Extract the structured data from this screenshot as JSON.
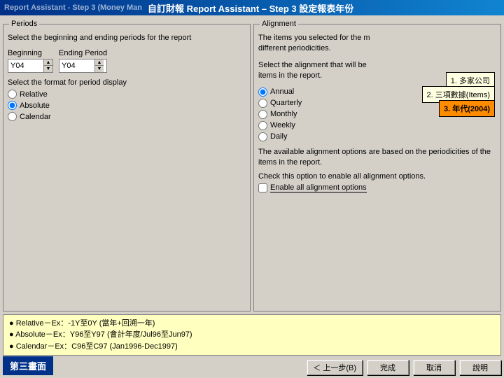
{
  "titleBar": {
    "left": "Report Assistant - Step 3  (Money Man",
    "right": "自訂財報 Report Assistant – Step 3 設定報表年份"
  },
  "periods": {
    "panelTitle": "Periods",
    "description": "Select the beginning and ending periods for the report",
    "beginLabel": "Beginning",
    "endLabel": "Ending Period",
    "beginValue": "Y04",
    "endValue": "Y04",
    "formatLabel": "Select the format for period display",
    "formats": [
      {
        "id": "relative",
        "label": "Relative",
        "checked": false
      },
      {
        "id": "absolute",
        "label": "Absolute",
        "checked": true
      },
      {
        "id": "calendar",
        "label": "Calendar",
        "checked": false
      }
    ]
  },
  "alignment": {
    "panelTitle": "Alignment",
    "description": "The items you selected for the m different periodicities.",
    "description2": "Select the alignment that will be items in the report.",
    "options": [
      {
        "id": "annual",
        "label": "Annual",
        "checked": true
      },
      {
        "id": "quarterly",
        "label": "Quarterly",
        "checked": false
      },
      {
        "id": "monthly",
        "label": "Monthly",
        "checked": false
      },
      {
        "id": "weekly",
        "label": "Weekly",
        "checked": false
      },
      {
        "id": "daily",
        "label": "Daily",
        "checked": false
      }
    ],
    "availText": "The available alignment options are based on the periodicities of the items in the report.",
    "checkText": "Check this option to enable all alignment options.",
    "checkLabel": "Enable all alignment options"
  },
  "tooltips": {
    "t1": "1. 多家公司",
    "t2": "2. 三項數據(Items)",
    "t3": "3. 年代(2004)"
  },
  "infoRows": [
    "● Relative－Ex：-1Y至0Y (當年+回溯一年)",
    "● Absolute－Ex：Y96至Y97 (會計年度/Jul96至Jun97)",
    "● Calendar－Ex：C96至C97 (Jan1996-Dec1997)"
  ],
  "buttons": {
    "back": "＜ 上一步(B)",
    "finish": "完成",
    "cancel": "取消",
    "help": "說明"
  },
  "cornerLabel": "第三畫面"
}
